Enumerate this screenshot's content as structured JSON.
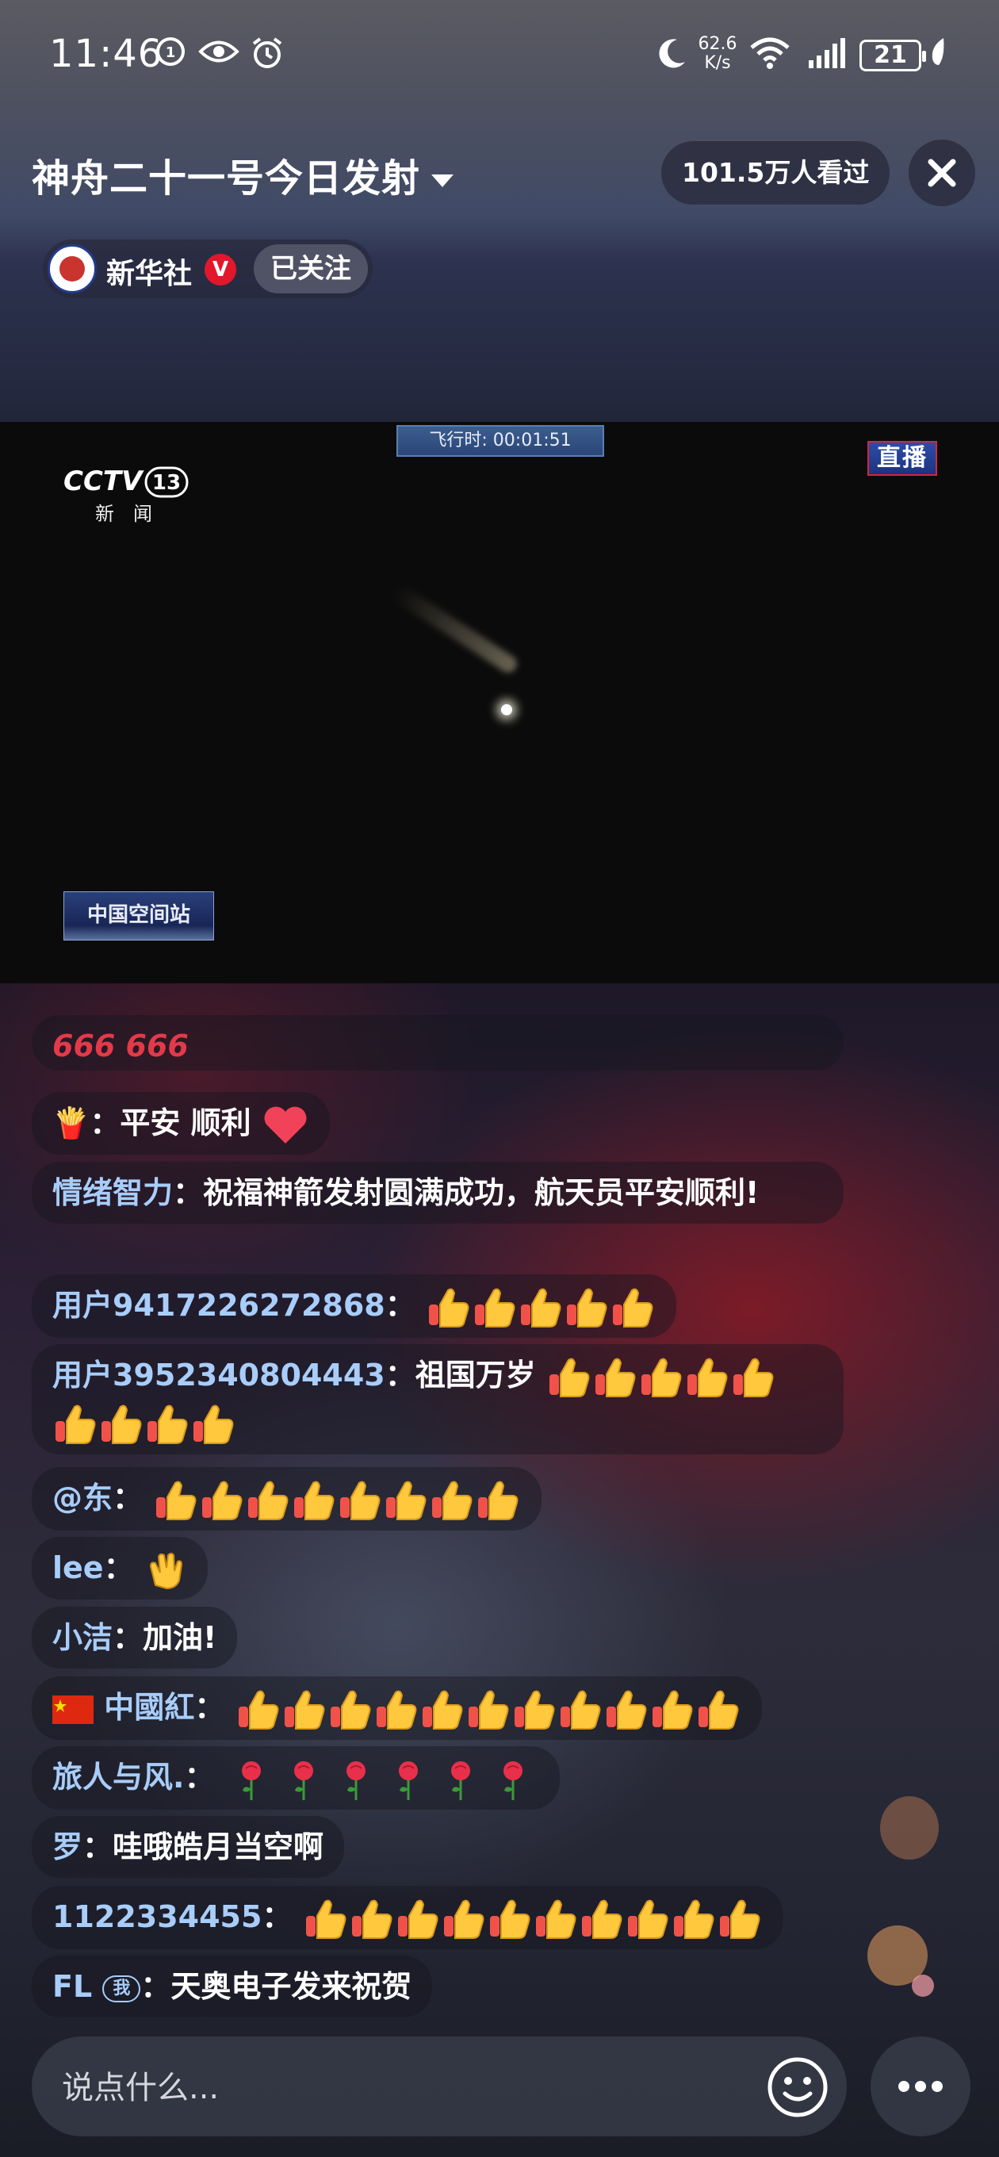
{
  "status_bar": {
    "time": "11:46",
    "net_speed_value": "62.6",
    "net_speed_unit": "K/s",
    "battery": "21"
  },
  "header": {
    "title": "神舟二十一号今日发射",
    "viewers": "101.5万人看过",
    "channel_name": "新华社",
    "verified_mark": "V",
    "follow_label": "已关注"
  },
  "video": {
    "flight_time": "飞行时: 00:01:51",
    "live_badge": "直播",
    "channel_logo": "CCTV",
    "channel_number": "13",
    "channel_sub": "新闻",
    "station_logo": "中国空间站"
  },
  "chat": {
    "messages": [
      {
        "user": "",
        "text": "666 666",
        "emoji": ""
      },
      {
        "user": "🍟",
        "text": "平安 顺利",
        "emoji": "heart"
      },
      {
        "user": "情绪智力",
        "text": "祝福神箭发射圆满成功，航天员平安顺利!",
        "emoji": ""
      },
      {
        "user": "用户9417226272868",
        "text": "",
        "emoji": "thumbs-up x5"
      },
      {
        "user": "用户3952340804443",
        "text": "祖国万岁",
        "emoji": "thumbs-up x9"
      },
      {
        "user": "@东",
        "text": "",
        "emoji": "thumbs-up x8"
      },
      {
        "user": "lee",
        "text": "",
        "emoji": "clapping-hands"
      },
      {
        "user": "小洁",
        "text": "加油!",
        "emoji": ""
      },
      {
        "user": "中國紅",
        "text": "",
        "emoji": "thumbs-up x11"
      },
      {
        "user": "旅人与风.",
        "text": "",
        "emoji": "rose x6"
      },
      {
        "user": "罗",
        "text": "哇哦皓月当空啊",
        "emoji": ""
      },
      {
        "user": "1122334455",
        "text": "",
        "emoji": "thumbs-up x10"
      },
      {
        "user": "FL",
        "badge": "我",
        "text": "天奥电子发来祝贺",
        "emoji": ""
      }
    ]
  },
  "input": {
    "placeholder": "说点什么..."
  },
  "colors": {
    "username": "#a8cdfa",
    "verified_red": "#e3172b",
    "thumb_yellow": "#ffc83d"
  }
}
